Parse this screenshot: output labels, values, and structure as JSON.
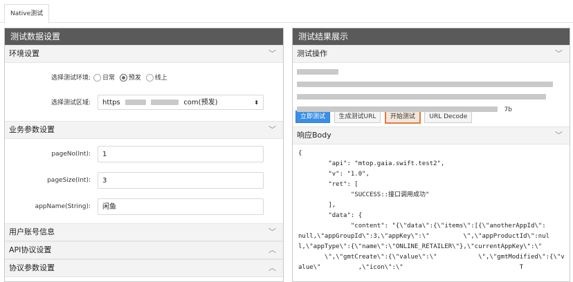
{
  "tab": {
    "label": "Native测试"
  },
  "left": {
    "title": "测试数据设置",
    "env_section": "环境设置",
    "env_label": "选择测试环境:",
    "env_options": [
      "日常",
      "预发",
      "线上"
    ],
    "region_label": "选择测试区域:",
    "region_value_prefix": "https",
    "region_value_suffix": "com(预发)",
    "biz_section": "业务参数设置",
    "fields": [
      {
        "label": "pageNo(Int):",
        "value": "1"
      },
      {
        "label": "pageSize(Int):",
        "value": "3"
      },
      {
        "label": "appName(String):",
        "value": "闲鱼"
      }
    ],
    "sections_bottom": [
      "用户账号信息",
      "API协议设置",
      "协议参数设置"
    ]
  },
  "right": {
    "title": "测试结果展示",
    "op_section": "测试操作",
    "op_tail": "7b",
    "buttons": {
      "run": "立即测试",
      "gen": "生成测试URL",
      "start": "开始测试",
      "decode": "URL Decode"
    },
    "resp_section": "响应Body",
    "json_lines": [
      "{",
      "        \"api\": \"mtop.gaia.swift.test2\",",
      "        \"v\": \"1.0\",",
      "        \"ret\": [",
      "              \"SUCCESS::接口调用成功\"",
      "        ],",
      "        \"data\": {",
      "              \"content\": \"{\\\"data\\\":{\\\"items\\\":[{\\\"anotherAppId\\\":",
      "null,\\\"appGroupId\\\":3,\\\"appKey\\\":\\\"         \\\",\\\"appProductId\\\":nul",
      "l,\\\"appType\\\":{\\\"name\\\":\\\"ONLINE_RETAILER\\\"},\\\"currentAppKey\\\":\\\"",
      "       \\\",\\\"gmtCreate\\\":{\\\"value\\\":\\\"           \\\",\\\"gmtModified\\\":{\\\"v",
      "alue\\\"          ,\\\"icon\\\":\\\"                               T"
    ]
  },
  "colors": {
    "header": "#5a5a5a",
    "primary": "#3a8ee6",
    "start_border": "#e07a3a"
  }
}
